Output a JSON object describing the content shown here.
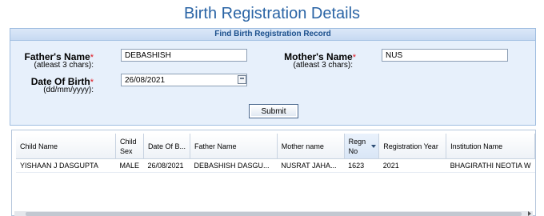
{
  "page": {
    "title": "Birth Registration Details"
  },
  "search": {
    "header": "Find Birth Registration Record",
    "father": {
      "label": "Father's Name",
      "required": "*",
      "hint": "(atleast 3 chars):",
      "value": "DEBASHISH"
    },
    "mother": {
      "label": "Mother's Name",
      "required": "*",
      "hint": "(atleast 3 chars):",
      "value": "NUS"
    },
    "dob": {
      "label": "Date Of Birth",
      "required": "*",
      "hint": "(dd/mm/yyyy):",
      "value": "26/08/2021",
      "icon": "calendar-icon"
    },
    "submit_label": "Submit"
  },
  "results": {
    "columns": [
      {
        "label": "Child Name"
      },
      {
        "label": "Child Sex"
      },
      {
        "label": "Date Of B..."
      },
      {
        "label": "Father Name"
      },
      {
        "label": "Mother name"
      },
      {
        "label": "Regn No",
        "sorted": "descending"
      },
      {
        "label": "Registration Year"
      },
      {
        "label": "Institution Name"
      }
    ],
    "rows": [
      [
        "YISHAAN J DASGUPTA",
        "MALE",
        "26/08/2021",
        "DEBASHISH DASGU...",
        "NUSRAT JAHA...",
        "1623",
        "2021",
        "BHAGIRATHI NEOTIA W"
      ]
    ]
  },
  "colors": {
    "title": "#2a64a5",
    "required": "#e0161e",
    "panel_bg": "#e7f0fb",
    "panel_header_text": "#1b4f8c"
  }
}
